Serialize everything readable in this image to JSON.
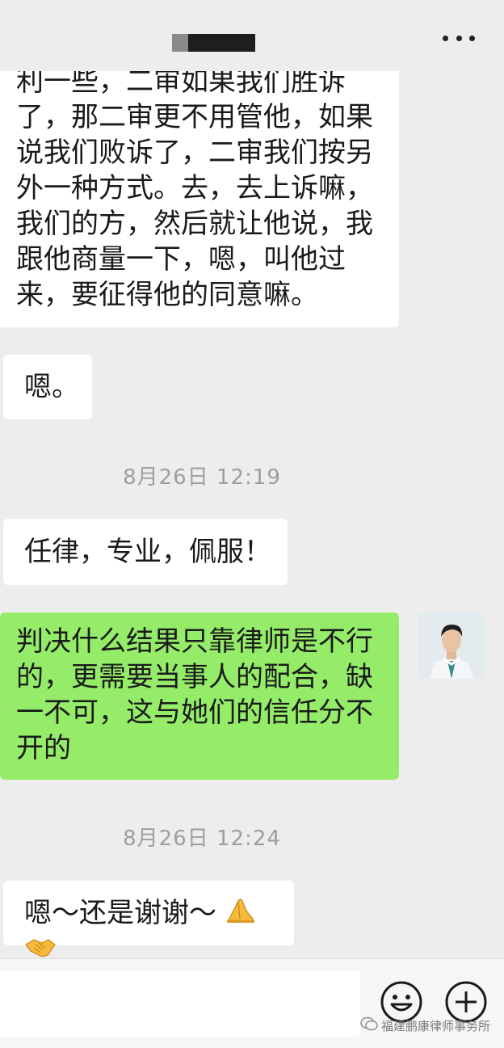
{
  "header": {
    "title": "",
    "more_icon": "more-dots-icon"
  },
  "messages": [
    {
      "side": "left",
      "lines": [
        "利一些，二审如果我们胜诉",
        "了，那二审更不用管他，如果",
        "说我们败诉了，二审我们按另",
        "外一种方式。去，去上诉嘛，",
        "我们的方，然后就让他说，我",
        "跟他商量一下，嗯，叫他过",
        "来，要征得他的同意嘛。"
      ]
    },
    {
      "side": "left",
      "lines": [
        "嗯。"
      ]
    },
    {
      "type": "timestamp",
      "text": "8月26日 12:19"
    },
    {
      "side": "left",
      "lines": [
        "任律，专业，佩服！"
      ]
    },
    {
      "side": "right",
      "lines": [
        "判决什么结果只靠律师是不行",
        "的，更需要当事人的配合，缺",
        "一不可，这与她们的信任分不",
        "开的"
      ]
    },
    {
      "type": "timestamp",
      "text": "8月26日 12:24"
    },
    {
      "side": "left",
      "text": "嗯～还是谢谢～",
      "emojis": [
        "folded-hands-icon",
        "handshake-icon"
      ]
    }
  ],
  "composer": {
    "input_value": "",
    "emoji_button": "smiley-face-icon",
    "plus_button": "plus-circle-icon"
  },
  "watermark": {
    "text": "福建鹏康律师事务所",
    "icon": "wechat-official-account-icon"
  },
  "colors": {
    "background": "#ededed",
    "self_bubble": "#95ec69",
    "other_bubble": "#ffffff",
    "timestamp_text": "#9e9e9e"
  }
}
